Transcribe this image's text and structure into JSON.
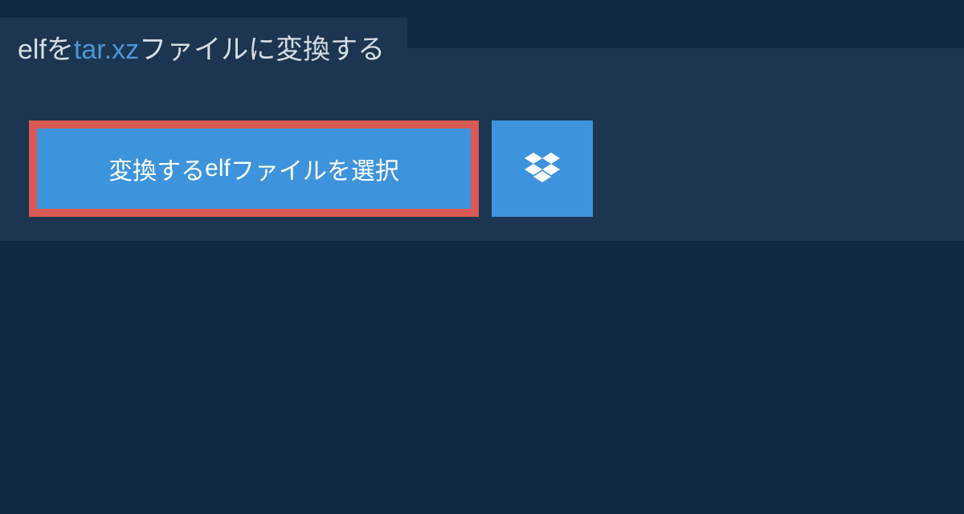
{
  "title": {
    "src_format": "elf",
    "mid1": "を",
    "dst_format": "tar.xz",
    "mid2": "ファイルに変換する"
  },
  "buttons": {
    "select_prefix": "変換する",
    "select_format": "elf",
    "select_suffix": "ファイルを選択"
  },
  "colors": {
    "background": "#0f2844",
    "panel": "#1c3550",
    "button": "#3e94dc",
    "highlight_border": "#d95a55",
    "title_text": "#d5dde4",
    "dst_format_text": "#4b96d9"
  },
  "icons": {
    "dropbox": "dropbox-icon"
  }
}
